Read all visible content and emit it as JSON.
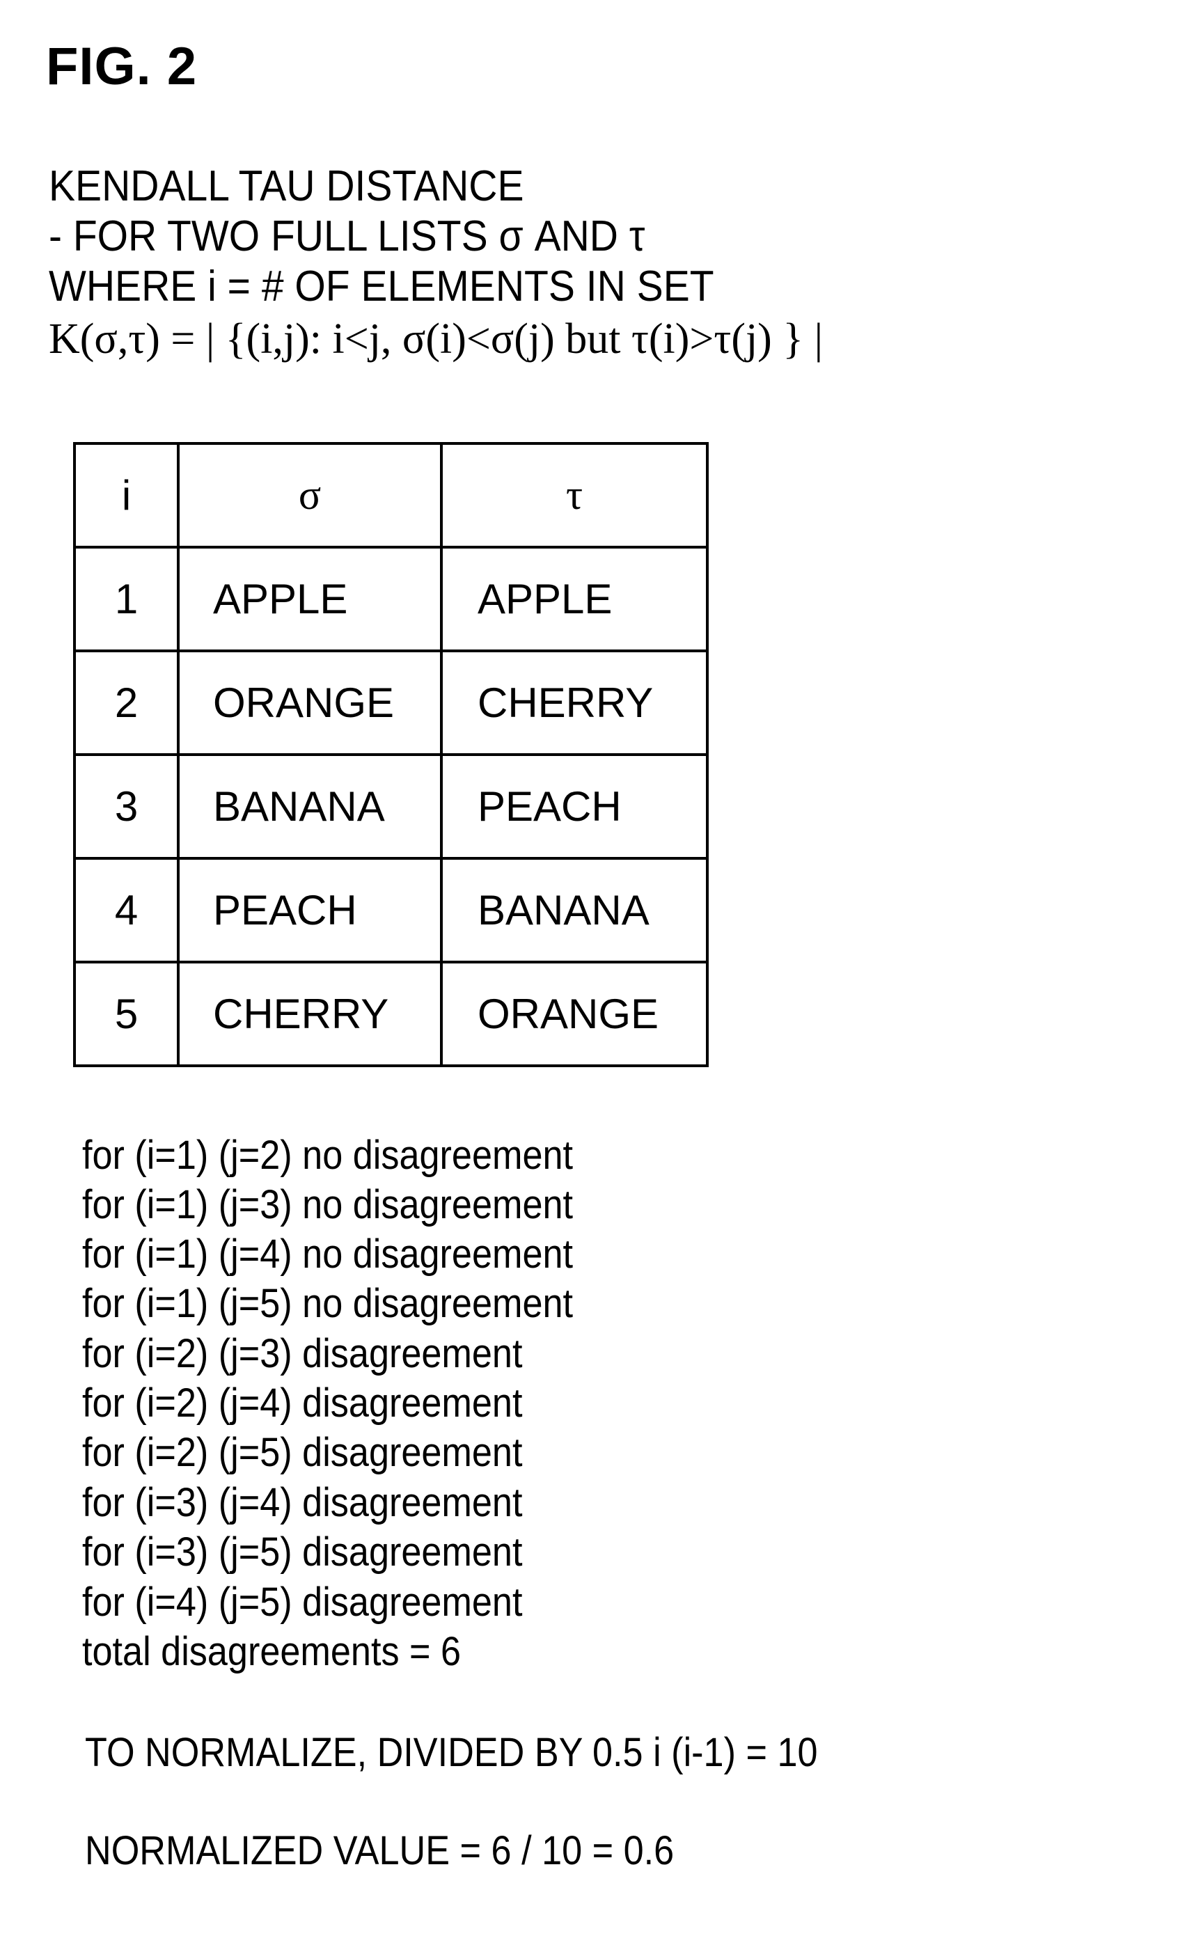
{
  "figure_label": "FIG. 2",
  "header": {
    "title": "KENDALL TAU DISTANCE",
    "subtitle": "- FOR TWO FULL LISTS σ AND τ",
    "where": "WHERE  i = # OF ELEMENTS IN SET",
    "formula": "K(σ,τ) = | {(i,j): i<j, σ(i)<σ(j) but τ(i)>τ(j) } |"
  },
  "table": {
    "columns": [
      "i",
      "σ",
      "τ"
    ],
    "rows": [
      {
        "i": "1",
        "sigma": "APPLE",
        "tau": "APPLE"
      },
      {
        "i": "2",
        "sigma": "ORANGE",
        "tau": "CHERRY"
      },
      {
        "i": "3",
        "sigma": "BANANA",
        "tau": "PEACH"
      },
      {
        "i": "4",
        "sigma": "PEACH",
        "tau": "BANANA"
      },
      {
        "i": "5",
        "sigma": "CHERRY",
        "tau": "ORANGE"
      }
    ]
  },
  "pairs": [
    "for (i=1) (j=2) no disagreement",
    "for (i=1) (j=3) no disagreement",
    "for (i=1) (j=4) no disagreement",
    "for (i=1) (j=5) no disagreement",
    "for (i=2) (j=3) disagreement",
    "for (i=2) (j=4) disagreement",
    "for (i=2) (j=5) disagreement",
    "for (i=3) (j=4) disagreement",
    "for (i=3) (j=5) disagreement",
    "for (i=4) (j=5) disagreement"
  ],
  "total": "total disagreements = 6",
  "normalize": "TO NORMALIZE, DIVIDED BY 0.5 i (i-1) = 10",
  "normalized_value": "NORMALIZED VALUE = 6 / 10 = 0.6"
}
